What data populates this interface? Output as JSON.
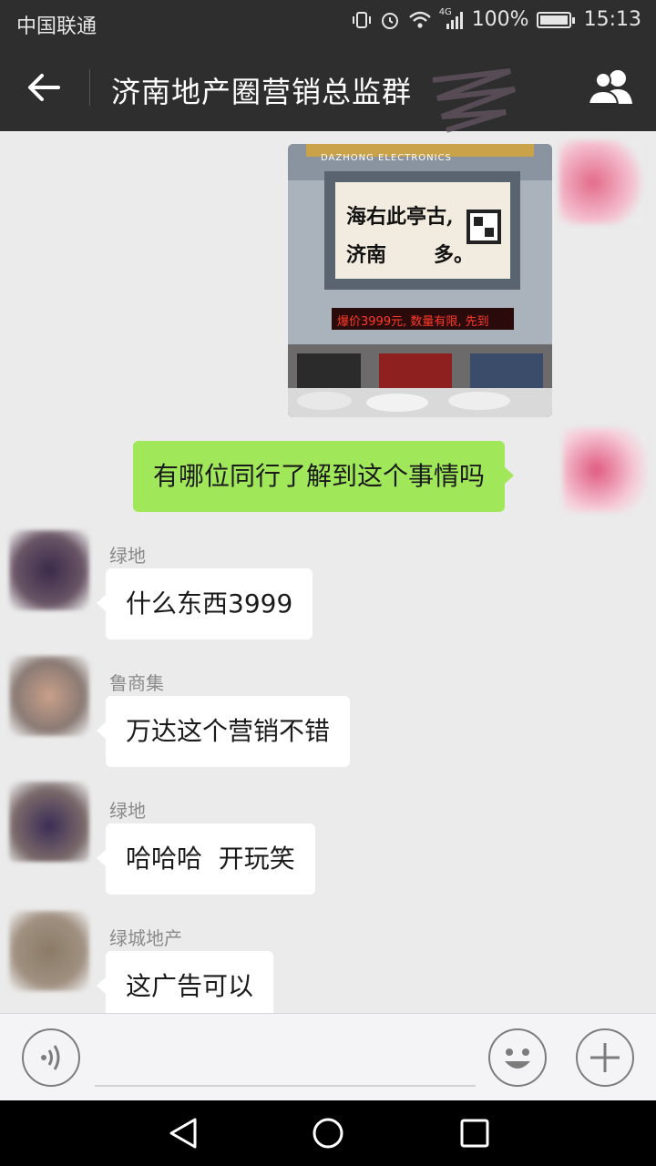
{
  "status_bar": {
    "carrier": "中国联通",
    "network": "4G",
    "battery": "100%",
    "time": "15:13"
  },
  "header": {
    "title": "济南地产圈营销总监群"
  },
  "messages": {
    "image_sign_line1": "海右此亭古,",
    "image_sign_line2": "济南",
    "image_sign_line2b": "多。",
    "image_store_text": "DAZHONG ELECTRONICS",
    "image_led_text": "爆价3999元, 数量有限, 先到",
    "my_text": "有哪位同行了解到这个事情吗",
    "m1_sender": "绿地",
    "m1_text": "什么东西3999",
    "m2_sender": "鲁商集",
    "m2_text": "万达这个营销不错",
    "m3_sender": "绿地",
    "m3_text": "哈哈哈  开玩笑",
    "m4_sender": "绿城地产",
    "m4_text": "这广告可以"
  },
  "input_bar": {
    "voice_icon": "voice-icon",
    "emoji_icon": "emoji-icon",
    "plus_icon": "plus-icon"
  },
  "colors": {
    "bar_dark": "#2e2e2e",
    "chat_bg": "#ebebeb",
    "my_bubble": "#a0e75a",
    "other_bubble": "#ffffff"
  }
}
